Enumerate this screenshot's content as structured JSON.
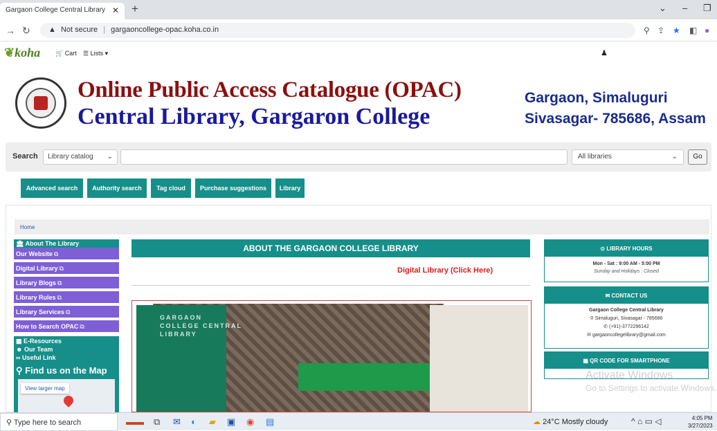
{
  "browser": {
    "tab_title": "Gargaon College Central Library",
    "tab_close": "✕",
    "new_tab": "+",
    "not_secure": "Not secure",
    "url": "gargaoncollege-opac.koha.co.in"
  },
  "koha_nav": {
    "logo": "koha",
    "cart": "Cart",
    "lists": "Lists"
  },
  "header": {
    "title_line1": "Online Public Access Catalogue (OPAC)",
    "title_line2": "Central Library, Gargaron College",
    "address_line1": "Gargaon, Simaluguri",
    "address_line2": "Sivasagar- 785686, Assam"
  },
  "search": {
    "label": "Search",
    "catalog_option": "Library catalog",
    "libraries_option": "All libraries",
    "go": "Go"
  },
  "nav_buttons": [
    "Advanced search",
    "Authority search",
    "Tag cloud",
    "Purchase suggestions",
    "Library"
  ],
  "breadcrumb": "Home",
  "sidebar": {
    "about": "About The Library",
    "items": [
      "Our Website",
      "Digital Library",
      "Library Blogs",
      "Library Rules",
      "Library Services",
      "How to Search OPAC"
    ],
    "eresources": "E-Resources",
    "our_team": "Our Team",
    "useful_link": "Useful Link",
    "find_map": "Find us on the Map",
    "map_button": "View larger map"
  },
  "center": {
    "heading": "ABOUT THE GARGAON COLLEGE LIBRARY",
    "digital_link": "Digital Library (Click Here)",
    "sign_text": "GARGAON COLLEGE CENTRAL LIBRARY"
  },
  "right": {
    "hours_title": "LIBRARY HOURS",
    "hours_line1": "Mon - Sat : 9:00 AM - 5:00 PM",
    "hours_line2": "Sunday and Holidays : Closed",
    "contact_title": "CONTACT US",
    "contact_name": "Gargaon College Central Library",
    "contact_addr": "Simaluguri, Sivasagar - 785686",
    "contact_phone": "(+91)-3772296142",
    "contact_email": "gargaoncollegelibrary@gmail.com",
    "qr_title": "QR CODE FOR SMARTPHONE"
  },
  "watermark": {
    "line1": "Activate Windows",
    "line2": "Go to Settings to activate Windows."
  },
  "taskbar": {
    "search_placeholder": "Type here to search",
    "weather": "24°C  Mostly cloudy",
    "time": "4:05 PM",
    "date": "3/27/2023"
  },
  "colors": {
    "teal": "#168f8a",
    "purple": "#7e5fd6",
    "title_red": "#8b1010",
    "title_blue": "#1a1a9c",
    "link_red": "#e01b1b"
  }
}
